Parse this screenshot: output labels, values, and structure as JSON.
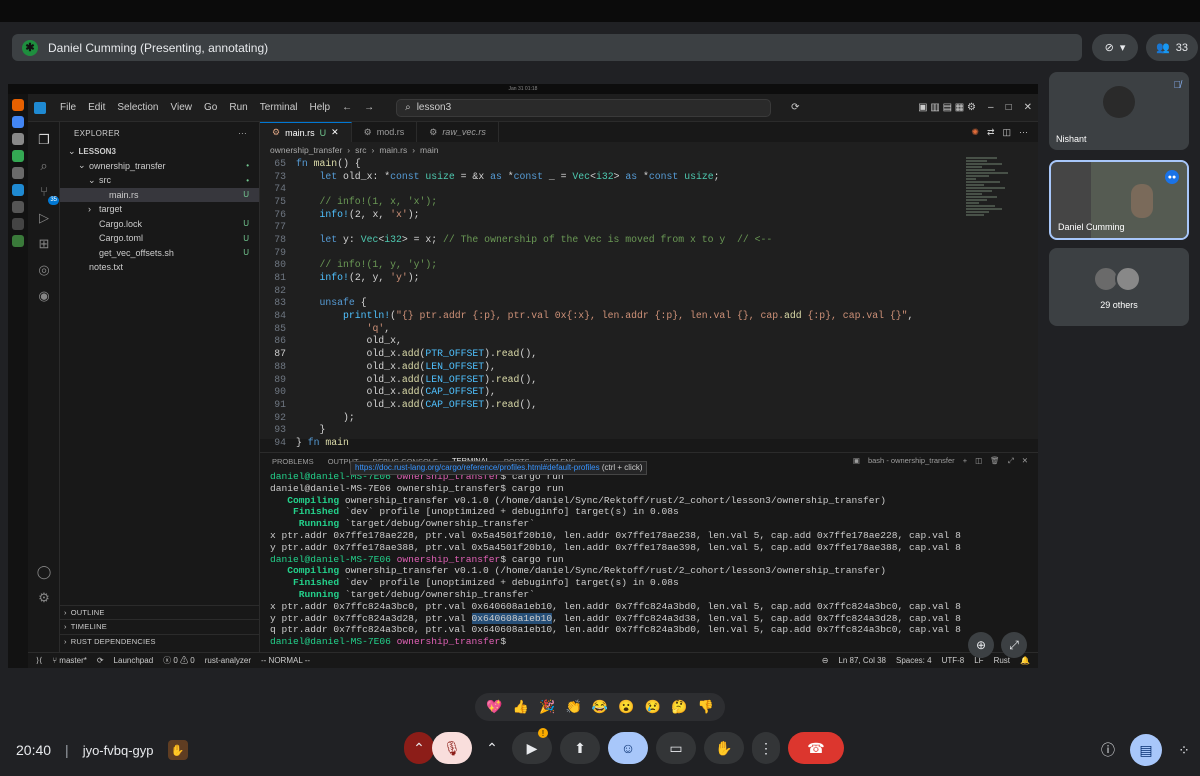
{
  "meet": {
    "presenter_banner": "Daniel Cumming (Presenting, annotating)",
    "participant_count": "33",
    "time": "20:40",
    "meeting_code": "jyo-fvbq-gyp",
    "reactions": [
      "💖",
      "👍",
      "🎉",
      "👏",
      "😂",
      "😮",
      "😢",
      "🤔",
      "👎"
    ],
    "participants": [
      {
        "name": "Nishant"
      },
      {
        "name": "Daniel Cumming"
      },
      {
        "name": "29 others"
      }
    ]
  },
  "vscode": {
    "menu": [
      "File",
      "Edit",
      "Selection",
      "View",
      "Go",
      "Run",
      "Terminal",
      "Help"
    ],
    "search": "lesson3",
    "source_control_badge": "35",
    "explorer": {
      "title": "EXPLORER",
      "root": "LESSON3",
      "items": [
        {
          "label": "ownership_transfer",
          "status": "•",
          "indent": 1,
          "chev": "⌄"
        },
        {
          "label": "src",
          "status": "•",
          "indent": 2,
          "chev": "⌄"
        },
        {
          "label": "main.rs",
          "status": "U",
          "indent": 3,
          "chev": ""
        },
        {
          "label": "target",
          "status": "",
          "indent": 2,
          "chev": "›"
        },
        {
          "label": "Cargo.lock",
          "status": "U",
          "indent": 2,
          "chev": ""
        },
        {
          "label": "Cargo.toml",
          "status": "U",
          "indent": 2,
          "chev": ""
        },
        {
          "label": "get_vec_offsets.sh",
          "status": "U",
          "indent": 2,
          "chev": ""
        },
        {
          "label": "notes.txt",
          "status": "",
          "indent": 1,
          "chev": ""
        }
      ],
      "sections": [
        "OUTLINE",
        "TIMELINE",
        "RUST DEPENDENCIES"
      ]
    },
    "tabs": [
      {
        "label": "main.rs",
        "mod": "U",
        "active": true
      },
      {
        "label": "mod.rs",
        "mod": "",
        "active": false
      },
      {
        "label": "raw_vec.rs",
        "mod": "",
        "active": false
      }
    ],
    "breadcrumbs": [
      "ownership_transfer",
      "src",
      "main.rs",
      "main"
    ],
    "code": [
      {
        "n": "65",
        "t": "fn main() {"
      },
      {
        "n": "73",
        "t": "    let old_x: *const usize = &x as *const _ = Vec<i32> as *const usize;"
      },
      {
        "n": "74",
        "t": ""
      },
      {
        "n": "75",
        "t": "    // info!(1, x, 'x');"
      },
      {
        "n": "76",
        "t": "    info!(2, x, 'x');"
      },
      {
        "n": "77",
        "t": ""
      },
      {
        "n": "78",
        "t": "    let y: Vec<i32> = x; // The ownership of the Vec is moved from x to y  // <--"
      },
      {
        "n": "79",
        "t": ""
      },
      {
        "n": "80",
        "t": "    // info!(1, y, 'y');"
      },
      {
        "n": "81",
        "t": "    info!(2, y, 'y');"
      },
      {
        "n": "82",
        "t": ""
      },
      {
        "n": "83",
        "t": "    unsafe {"
      },
      {
        "n": "84",
        "t": "        println!(\"{} ptr.addr {:p}, ptr.val 0x{:x}, len.addr {:p}, len.val {}, cap.add {:p}, cap.val {}\","
      },
      {
        "n": "85",
        "t": "            'q',"
      },
      {
        "n": "86",
        "t": "            old_x,"
      },
      {
        "n": "87",
        "t": "            old_x.add(PTR_OFFSET).read(),"
      },
      {
        "n": "88",
        "t": "            old_x.add(LEN_OFFSET),"
      },
      {
        "n": "89",
        "t": "            old_x.add(LEN_OFFSET).read(),"
      },
      {
        "n": "90",
        "t": "            old_x.add(CAP_OFFSET),"
      },
      {
        "n": "91",
        "t": "            old_x.add(CAP_OFFSET).read(),"
      },
      {
        "n": "92",
        "t": "        );"
      },
      {
        "n": "93",
        "t": "    }"
      },
      {
        "n": "94",
        "t": "} fn main"
      }
    ],
    "panel_tabs": [
      "PROBLEMS",
      "OUTPUT",
      "DEBUG CONSOLE",
      "TERMINAL",
      "PORTS",
      "GITLENS"
    ],
    "terminal_title": "bash - ownership_transfer",
    "tooltip_link": "https://doc.rust-lang.org/cargo/reference/profiles.html#default-profiles",
    "tooltip_hint": "(ctrl + click)",
    "terminal": [
      {
        "u": "daniel@daniel-MS-7E06",
        "d": "ownership_transfer",
        "c": "$ cargo run"
      },
      {
        "r": "daniel@daniel-MS-7E06 ownership_transfer$ cargo run"
      },
      {
        "k": "   Compiling",
        "v": " ownership_transfer v0.1.0 (/home/daniel/Sync/Rektoff/rust/2_cohort/lesson3/ownership_transfer)"
      },
      {
        "k": "    Finished",
        "v": " `dev` profile [unoptimized + debuginfo] target(s) in 0.08s"
      },
      {
        "k": "     Running",
        "v": " `target/debug/ownership_transfer`"
      },
      {
        "v": "x ptr.addr 0x7ffe178ae228, ptr.val 0x5a4501f20b10, len.addr 0x7ffe178ae238, len.val 5, cap.add 0x7ffe178ae228, cap.val 8"
      },
      {
        "v": "y ptr.addr 0x7ffe178ae388, ptr.val 0x5a4501f20b10, len.addr 0x7ffe178ae398, len.val 5, cap.add 0x7ffe178ae388, cap.val 8"
      },
      {
        "u": "daniel@daniel-MS-7E06",
        "d": "ownership_transfer",
        "c": "$ cargo run"
      },
      {
        "k": "   Compiling",
        "v": " ownership_transfer v0.1.0 (/home/daniel/Sync/Rektoff/rust/2_cohort/lesson3/ownership_transfer)"
      },
      {
        "k": "    Finished",
        "v": " `dev` profile [unoptimized + debuginfo] target(s) in 0.08s"
      },
      {
        "k": "     Running",
        "v": " `target/debug/ownership_transfer`"
      },
      {
        "v": "x ptr.addr 0x7ffc824a3bc0, ptr.val 0x640608a1eb10, len.addr 0x7ffc824a3bd0, len.val 5, cap.add 0x7ffc824a3bc0, cap.val 8"
      },
      {
        "p": "y ptr.addr 0x7ffc824a3d28, ptr.val ",
        "h": "0x640608a1eb10",
        "s": ", len.addr 0x7ffc824a3d38, len.val 5, cap.add 0x7ffc824a3d28, cap.val 8"
      },
      {
        "v": "q ptr.addr 0x7ffc824a3bc0, ptr.val 0x640608a1eb10, len.addr 0x7ffc824a3bd0, len.val 5, cap.add 0x7ffc824a3bc0, cap.val 8"
      },
      {
        "u": "daniel@daniel-MS-7E06",
        "d": "ownership_transfer",
        "c": "$ "
      }
    ],
    "status": {
      "branch": "master*",
      "launchpad": "Launchpad",
      "errors": "0",
      "warnings": "0",
      "lsp": "rust-analyzer",
      "mode": "-- NORMAL --",
      "position": "Ln 87, Col 38",
      "spaces": "Spaces: 4",
      "encoding": "UTF-8",
      "eol": "LF",
      "lang": "Rust"
    }
  }
}
